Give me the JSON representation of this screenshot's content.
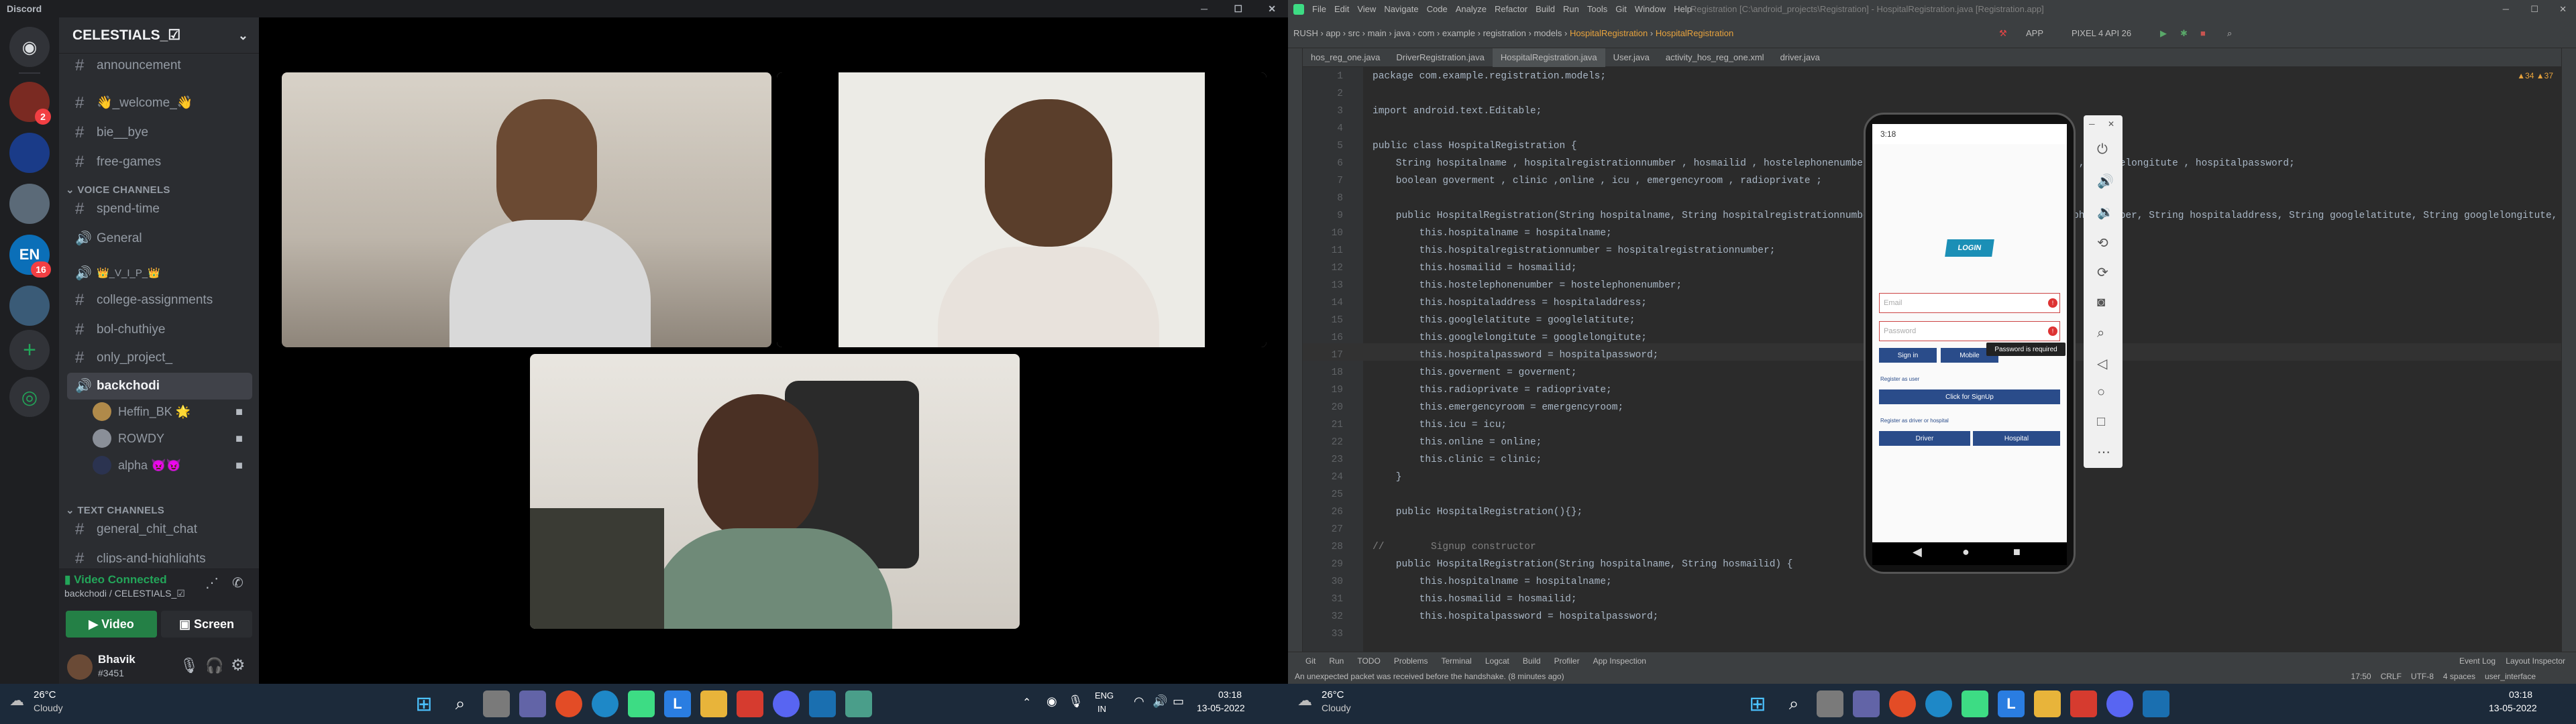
{
  "discord": {
    "title": "Discord",
    "guild_name": "CELESTIALS_☑",
    "channels_top": [
      {
        "name": "announcement",
        "type": "text"
      },
      {
        "name": "👋_welcome_👋",
        "type": "text"
      },
      {
        "name": "bie__bye",
        "type": "text"
      },
      {
        "name": "free-games",
        "type": "text"
      }
    ],
    "voice_category": "VOICE CHANNELS",
    "voice_channels": [
      {
        "name": "spend-time"
      },
      {
        "name": "General"
      },
      {
        "name": "👑_V_I_P_👑"
      }
    ],
    "text_channels_mid": [
      "college-assignments",
      "bol-chuthiye",
      "only_project_"
    ],
    "active_voice": "backchodi",
    "voice_users": [
      {
        "name": "Heffin_BK 🌟",
        "color": "#b08a4a"
      },
      {
        "name": "ROWDY",
        "color": "#888"
      },
      {
        "name": "alpha 👿😈",
        "color": "#334"
      }
    ],
    "text_category": "TEXT CHANNELS",
    "text_channels": [
      "general_chit_chat",
      "clips-and-highlights"
    ],
    "vc_status": "Video Connected",
    "vc_sub": "backchodi / CELESTIALS_☑",
    "video_btn": "Video",
    "screen_btn": "Screen",
    "user": {
      "name": "Bhavik",
      "tag": "#3451"
    },
    "server_badges": [
      "2",
      "16"
    ]
  },
  "taskbar": {
    "weather_left": {
      "temp": "26°C",
      "cond": "Cloudy"
    },
    "lang": "ENG",
    "region": "IN",
    "time": "03:18",
    "date": "13-05-2022"
  },
  "studio": {
    "menu": [
      "File",
      "Edit",
      "View",
      "Navigate",
      "Code",
      "Analyze",
      "Refactor",
      "Build",
      "Run",
      "Tools",
      "Git",
      "Window",
      "Help"
    ],
    "window_title": "Registration [C:\\android_projects\\Registration] - HospitalRegistration.java [Registration.app]",
    "breadcrumb": [
      "RUSH",
      "app",
      "src",
      "main",
      "java",
      "com",
      "example",
      "registration",
      "models",
      "HospitalRegistration",
      "HospitalRegistration"
    ],
    "run_config": "APP",
    "device": "PIXEL 4 API 26",
    "tabs": [
      "hos_reg_one.java",
      "DriverRegistration.java",
      "HospitalRegistration.java",
      "User.java",
      "activity_hos_reg_one.xml",
      "driver.java"
    ],
    "active_tab": 2,
    "warnings": "▲34 ▲37",
    "code": [
      "package com.example.registration.models;",
      "",
      "import android.text.Editable;",
      "",
      "public class HospitalRegistration {",
      "    String hospitalname , hospitalregistrationnumber , hosmailid , hostelephonenumber , hospitaladdress , googlelatitute , googlelongitute , hospitalpassword;",
      "    boolean goverment , clinic ,online , icu , emergencyroom , radioprivate ;",
      "",
      "    public HospitalRegistration(String hospitalname, String hospitalregistrationnumber, String hosmailid, String hostelephonenumber, String hospitaladdress, String googlelatitute, String googlelongitute,",
      "        this.hospitalname = hospitalname;",
      "        this.hospitalregistrationnumber = hospitalregistrationnumber;",
      "        this.hosmailid = hosmailid;",
      "        this.hostelephonenumber = hostelephonenumber;",
      "        this.hospitaladdress = hospitaladdress;",
      "        this.googlelatitute = googlelatitute;",
      "        this.googlelongitute = googlelongitute;",
      "        this.hospitalpassword = hospitalpassword;",
      "        this.goverment = goverment;",
      "        this.radioprivate = radioprivate;",
      "        this.emergencyroom = emergencyroom;",
      "        this.icu = icu;",
      "        this.online = online;",
      "        this.clinic = clinic;",
      "    }",
      "",
      "    public HospitalRegistration(){};",
      "",
      "//        Signup constructor",
      "    public HospitalRegistration(String hospitalname, String hosmailid) {",
      "        this.hospitalname = hospitalname;",
      "        this.hosmailid = hosmailid;",
      "        this.hospitalpassword = hospitalpassword;",
      "    "
    ],
    "bottom_tabs": [
      "Git",
      "Run",
      "TODO",
      "Problems",
      "Terminal",
      "Logcat",
      "Build",
      "Profiler",
      "App Inspection"
    ],
    "bottom_right_tabs": [
      "Event Log",
      "Layout Inspector"
    ],
    "status_msg": "An unexpected packet was received before the handshake. (8 minutes ago)",
    "status_right": [
      "17:50",
      "CRLF",
      "UTF-8",
      "4 spaces",
      "user_interface"
    ],
    "phone": {
      "logo": "LOGIN",
      "email_ph": "Email",
      "password_ph": "Password",
      "toast": "Password is required",
      "signin": "Sign in",
      "mobile": "Mobile",
      "register_q": "Register as user",
      "signup": "Click for SignUp",
      "register_as": "Register as driver or hospital",
      "driver": "Driver",
      "hospital": "Hospital",
      "status_time": "3:18"
    },
    "weather": {
      "temp": "26°C",
      "cond": "Cloudy"
    },
    "time": "03:18",
    "date": "13-05-2022"
  }
}
